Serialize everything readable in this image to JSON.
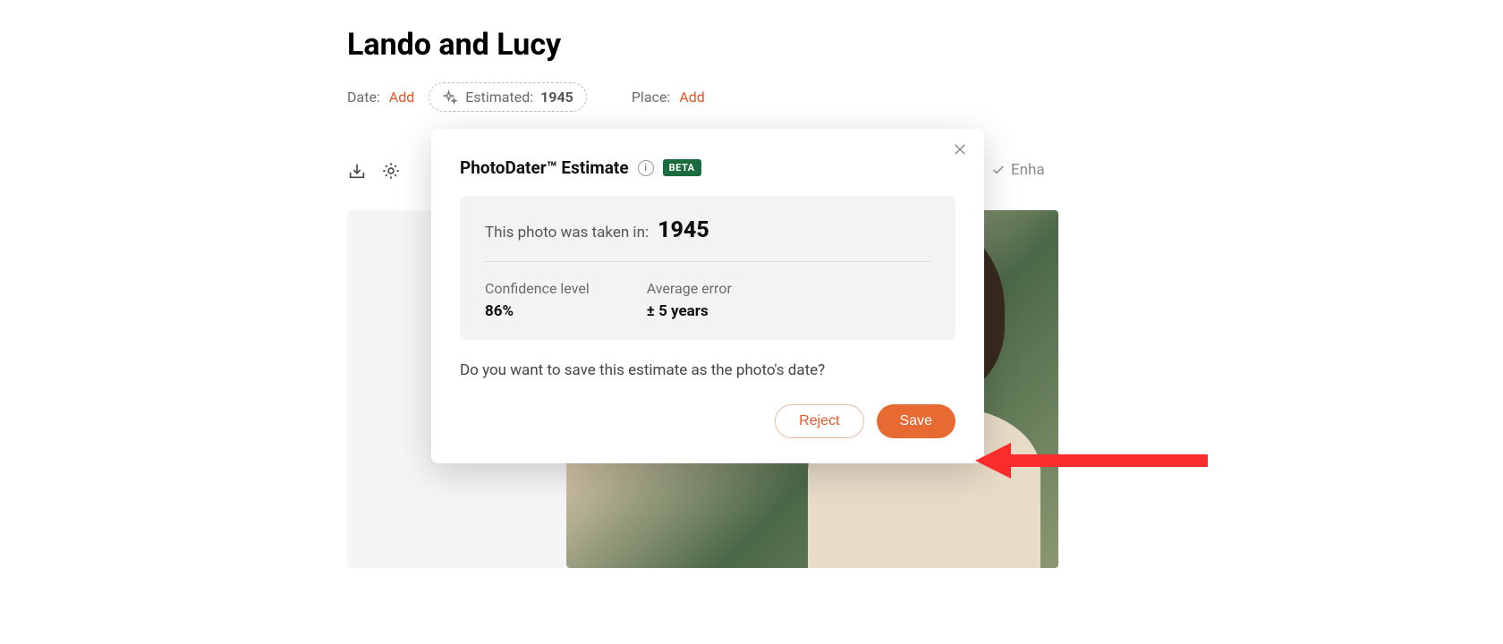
{
  "title": "Lando and Lucy",
  "meta": {
    "date_label": "Date:",
    "date_add": "Add",
    "estimated_prefix": "Estimated: ",
    "estimated_year": "1945",
    "place_label": "Place:",
    "place_add": "Add"
  },
  "enhance_text": "Enha",
  "popup": {
    "title": "PhotoDater™ Estimate",
    "info_glyph": "i",
    "beta": "BETA",
    "taken_label": "This photo was taken in:",
    "taken_year": "1945",
    "confidence_label": "Confidence level",
    "confidence_value": "86%",
    "error_label": "Average error",
    "error_value": "± 5 years",
    "prompt": "Do you want to save this estimate as the photo's date?",
    "reject": "Reject",
    "save": "Save"
  }
}
